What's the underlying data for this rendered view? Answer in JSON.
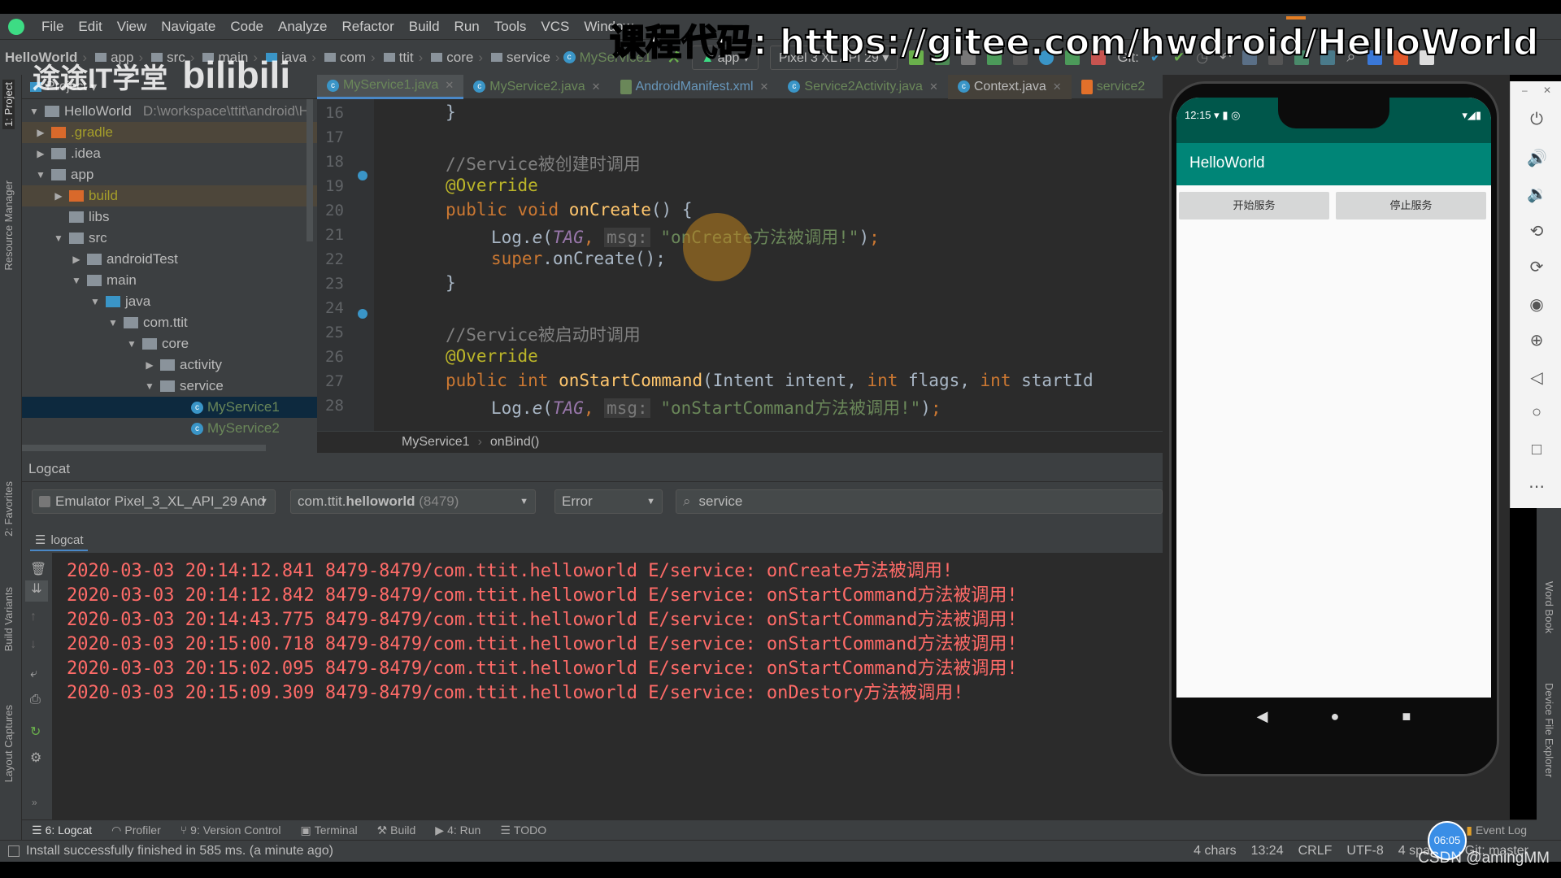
{
  "menu": [
    "File",
    "Edit",
    "View",
    "Navigate",
    "Code",
    "Analyze",
    "Refactor",
    "Build",
    "Run",
    "Tools",
    "VCS",
    "Window"
  ],
  "breadcrumb": [
    "HelloWorld",
    "app",
    "src",
    "main",
    "java",
    "com",
    "ttit",
    "core",
    "service",
    "MyService1"
  ],
  "toolbar": {
    "config": "app",
    "device": "Pixel 3 XL API 29",
    "git_label": "Git:"
  },
  "project_panel": {
    "title": "Project",
    "root": "HelloWorld",
    "root_path": "D:\\workspace\\ttit\\android\\H",
    "items": [
      {
        "label": ".gradle",
        "state": "collapsed",
        "type": "excluded"
      },
      {
        "label": ".idea",
        "state": "collapsed"
      },
      {
        "label": "app",
        "state": "expanded"
      },
      {
        "label": "build",
        "state": "collapsed",
        "type": "excluded"
      },
      {
        "label": "libs",
        "state": "leaf"
      },
      {
        "label": "src",
        "state": "expanded"
      },
      {
        "label": "androidTest",
        "state": "collapsed"
      },
      {
        "label": "main",
        "state": "expanded"
      },
      {
        "label": "java",
        "state": "expanded"
      },
      {
        "label": "com.ttit",
        "state": "expanded"
      },
      {
        "label": "core",
        "state": "expanded"
      },
      {
        "label": "activity",
        "state": "collapsed"
      },
      {
        "label": "service",
        "state": "expanded"
      },
      {
        "label": "MyService1",
        "type": "class",
        "selected": true
      },
      {
        "label": "MyService2",
        "type": "class"
      }
    ]
  },
  "side_tabs": {
    "project": "1: Project",
    "resource_manager": "Resource Manager",
    "favorites": "2: Favorites",
    "build_variants": "Build Variants",
    "layout_captures": "Layout Captures",
    "word_book": "Word Book",
    "device_file_explorer": "Device File Explorer"
  },
  "editor_tabs": [
    "MyService1.java",
    "MyService2.java",
    "AndroidManifest.xml",
    "Service2Activity.java",
    "Context.java",
    "service2"
  ],
  "code": {
    "line_numbers": [
      "16",
      "17",
      "18",
      "19",
      "20",
      "21",
      "22",
      "23",
      "24",
      "25",
      "26",
      "27",
      "28"
    ],
    "comment1": "//Service被创建时调用",
    "override": "@Override",
    "kw_public": "public",
    "kw_void": "void",
    "kw_int": "int",
    "kw_super": "super",
    "fn_oncreate": "onCreate",
    "fn_onstart": "onStartCommand",
    "log": "Log.",
    "log_e": "e",
    "tag": "TAG",
    "msg_hint": "msg:",
    "str1": "\"onCreate方法被调用!\"",
    "str2": "\"onStartCommand方法被调用!\"",
    "comment2": "//Service被启动时调用",
    "params": "Intent intent, ",
    "flags": " flags, ",
    "startid": " startId",
    "oncreate_call": ".onCreate();"
  },
  "editor_breadcrumb": [
    "MyService1",
    "onBind()"
  ],
  "logcat": {
    "title": "Logcat",
    "device": "Emulator Pixel_3_XL_API_29 And",
    "process_prefix": "com.ttit.",
    "process_bold": "helloworld",
    "process_pid": "(8479)",
    "level": "Error",
    "search": "service",
    "tab": "logcat",
    "lines": [
      "2020-03-03 20:14:12.841 8479-8479/com.ttit.helloworld E/service: onCreate方法被调用!",
      "2020-03-03 20:14:12.842 8479-8479/com.ttit.helloworld E/service: onStartCommand方法被调用!",
      "2020-03-03 20:14:43.775 8479-8479/com.ttit.helloworld E/service: onStartCommand方法被调用!",
      "2020-03-03 20:15:00.718 8479-8479/com.ttit.helloworld E/service: onStartCommand方法被调用!",
      "2020-03-03 20:15:02.095 8479-8479/com.ttit.helloworld E/service: onStartCommand方法被调用!",
      "2020-03-03 20:15:09.309 8479-8479/com.ttit.helloworld E/service: onDestory方法被调用!"
    ]
  },
  "phone": {
    "time": "12:15",
    "app_title": "HelloWorld",
    "start_button": "开始服务",
    "stop_button": "停止服务"
  },
  "bottom_tabs": [
    "6: Logcat",
    "Profiler",
    "9: Version Control",
    "Terminal",
    "Build",
    "4: Run",
    "TODO",
    "Event Log"
  ],
  "status": {
    "message": "Install successfully finished in 585 ms. (a minute ago)",
    "chars": "4 chars",
    "position": "13:24",
    "line_sep": "CRLF",
    "encoding": "UTF-8",
    "indent": "4 spaces",
    "git": "Git: master"
  },
  "overlay": {
    "course_code": "课程代码: https://gitee.com/hwdroid/HelloWorld",
    "channel": "途途IT学堂",
    "site": "bilibili",
    "clock": "06:05",
    "csdn": "CSDN @amingMM"
  },
  "colors": {
    "error_log": "#ff6b68",
    "teal": "#008577",
    "selection": "#0d293e"
  }
}
